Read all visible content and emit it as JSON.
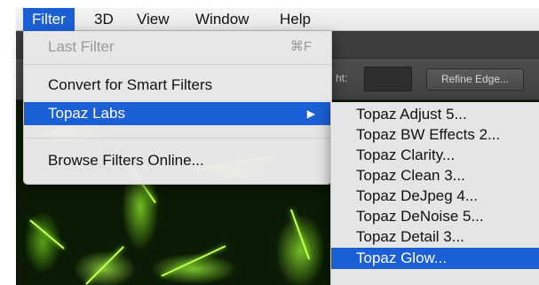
{
  "menubar": {
    "items": [
      {
        "label": "Filter",
        "active": true
      },
      {
        "label": "3D"
      },
      {
        "label": "View"
      },
      {
        "label": "Window"
      },
      {
        "label": "Help"
      }
    ]
  },
  "options_bar": {
    "height_label": "ht:",
    "refine_edge_label": "Refine Edge..."
  },
  "filter_menu": {
    "last_filter": {
      "label": "Last Filter",
      "shortcut": "⌘F",
      "disabled": true
    },
    "convert_smart": {
      "label": "Convert for Smart Filters"
    },
    "topaz_labs": {
      "label": "Topaz Labs",
      "submenu_arrow": "▶",
      "highlighted": true
    },
    "browse_online": {
      "label": "Browse Filters Online..."
    }
  },
  "topaz_submenu": {
    "items": [
      {
        "label": "Topaz Adjust 5..."
      },
      {
        "label": "Topaz BW Effects 2..."
      },
      {
        "label": "Topaz Clarity..."
      },
      {
        "label": "Topaz Clean 3..."
      },
      {
        "label": "Topaz DeJpeg 4..."
      },
      {
        "label": "Topaz DeNoise 5..."
      },
      {
        "label": "Topaz Detail 3..."
      },
      {
        "label": "Topaz Glow...",
        "highlighted": true
      }
    ]
  },
  "colors": {
    "highlight": "#1b5fd6",
    "menu_bg": "#ececec",
    "canvas_green": "#86ff1a"
  }
}
